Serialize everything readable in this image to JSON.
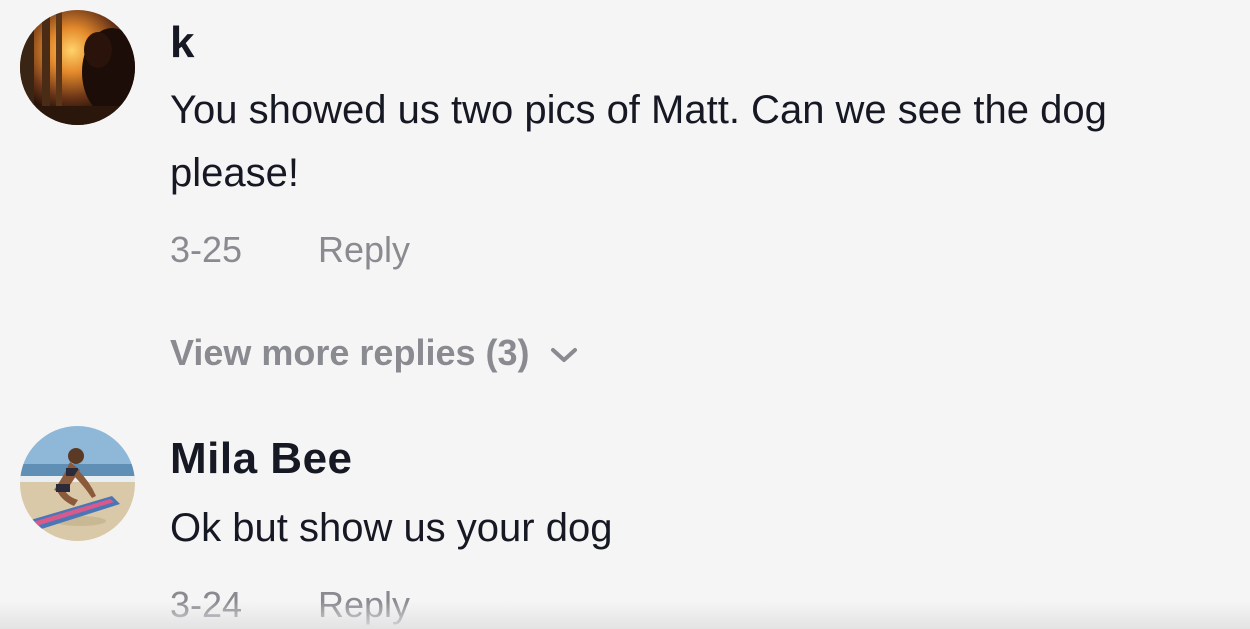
{
  "comments": [
    {
      "username": "k",
      "text": "You showed us two pics of Matt. Can we see the dog please!",
      "date": "3-25",
      "reply_label": "Reply",
      "view_more_label": "View more replies (3)"
    },
    {
      "username": "Mila Bee",
      "text": "Ok but show us your dog",
      "date": "3-24",
      "reply_label": "Reply"
    }
  ],
  "colors": {
    "background": "#f5f5f5",
    "primary_text": "#161823",
    "secondary_text": "#8a8b91"
  }
}
